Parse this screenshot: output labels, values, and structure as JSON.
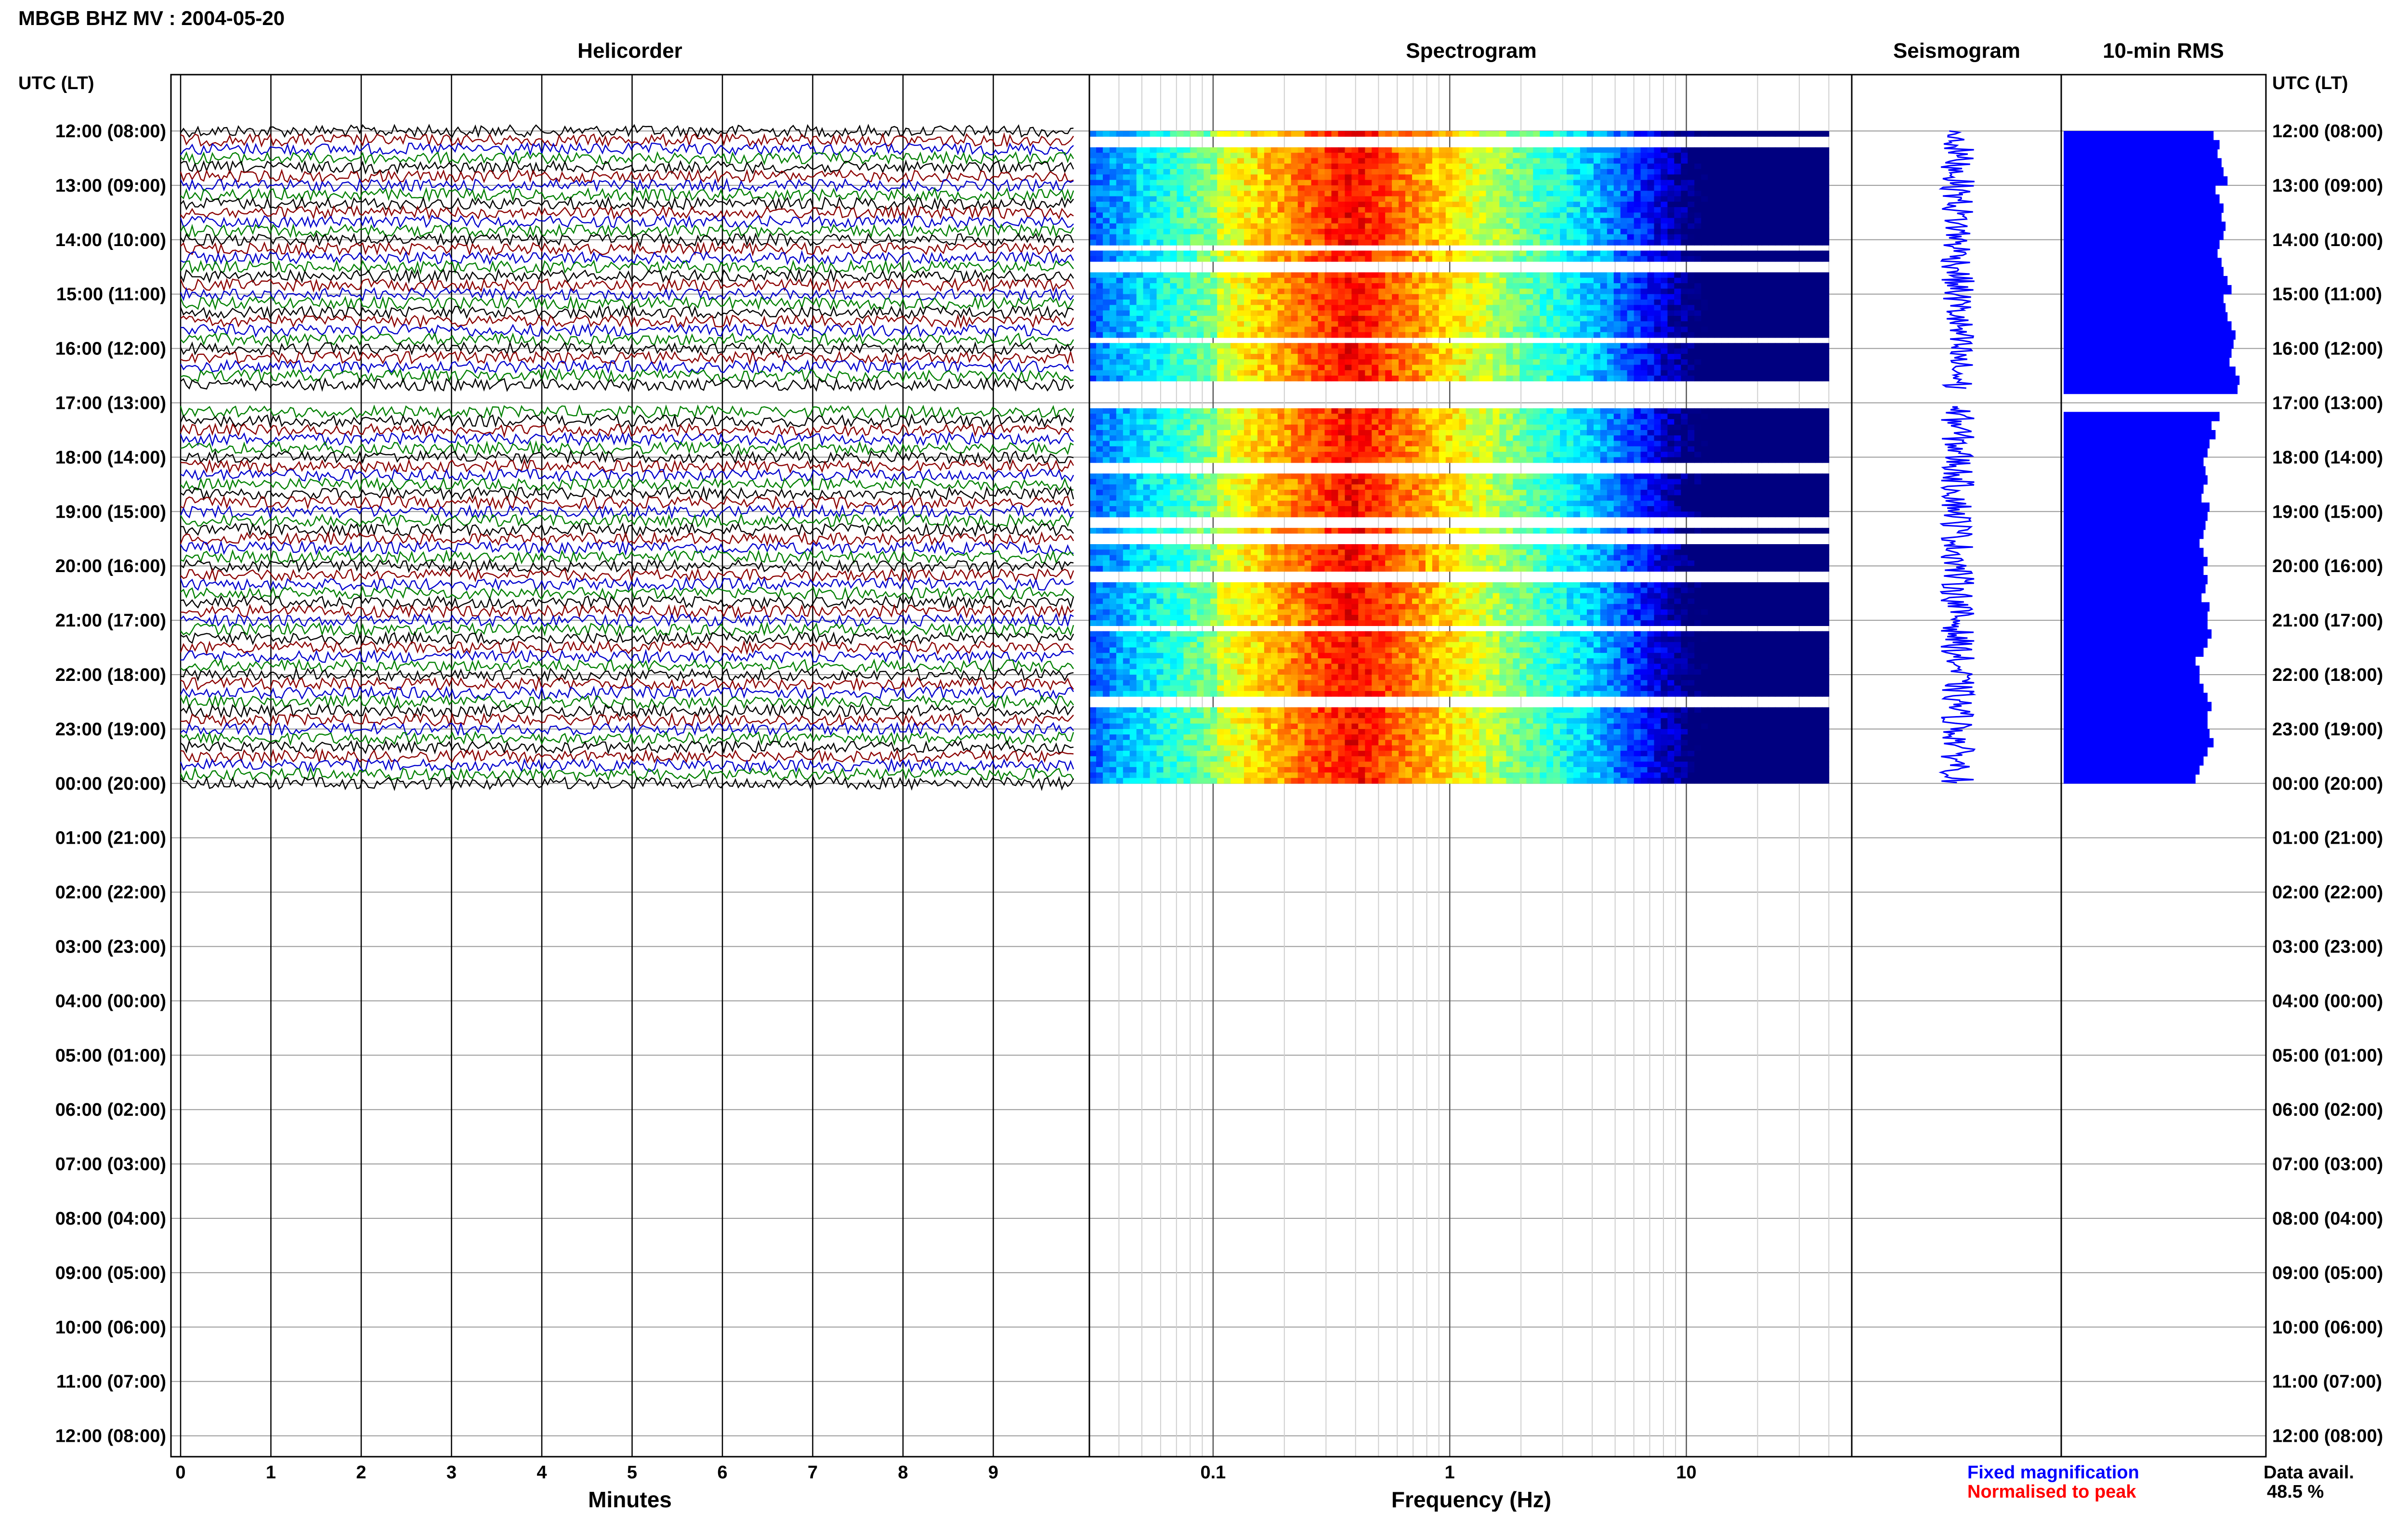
{
  "header": {
    "title": "MBGB BHZ MV : 2004-05-20",
    "utc_lt_label": "UTC (LT)"
  },
  "panels": {
    "helicorder": "Helicorder",
    "spectrogram": "Spectrogram",
    "seismogram": "Seismogram",
    "rms": "10-min RMS"
  },
  "footer": {
    "fixed_label": "Fixed magnification",
    "normalised_label": "Normalised to peak",
    "avail_label": "Data avail.",
    "avail_value": "48.5 %",
    "colors": {
      "fixed": "#0000ff",
      "normalised": "#ff0000"
    }
  },
  "chart_data": {
    "type": "heatmap",
    "time_labels": [
      "12:00 (08:00)",
      "13:00 (09:00)",
      "14:00 (10:00)",
      "15:00 (11:00)",
      "16:00 (12:00)",
      "17:00 (13:00)",
      "18:00 (14:00)",
      "19:00 (15:00)",
      "20:00 (16:00)",
      "21:00 (17:00)",
      "22:00 (18:00)",
      "23:00 (19:00)",
      "00:00 (20:00)",
      "01:00 (21:00)",
      "02:00 (22:00)",
      "03:00 (23:00)",
      "04:00 (00:00)",
      "05:00 (01:00)",
      "06:00 (02:00)",
      "07:00 (03:00)",
      "08:00 (04:00)",
      "09:00 (05:00)",
      "10:00 (06:00)",
      "11:00 (07:00)",
      "12:00 (08:00)"
    ],
    "helicorder": {
      "xlabel": "Minutes",
      "xticks": [
        "0",
        "1",
        "2",
        "3",
        "4",
        "5",
        "6",
        "7",
        "8",
        "9"
      ],
      "xlim": [
        0,
        10
      ],
      "trace_colors": [
        "#000000",
        "#8b0000",
        "#0000cd",
        "#008000"
      ],
      "data_hours": [
        0,
        12
      ],
      "gap_hours": [
        [
          4.75,
          5.05
        ]
      ]
    },
    "spectrogram": {
      "xlabel": "Frequency (Hz)",
      "xscale": "log",
      "xlim": [
        0.03,
        50
      ],
      "xticks": [
        "0.1",
        "1",
        "10"
      ],
      "data_fmax": 40,
      "peak_band_hz": [
        0.25,
        0.6
      ],
      "gap_hours": [
        0.2,
        2.15,
        2.5,
        3.85,
        4.7,
        5.05,
        6.2,
        7.2,
        7.5,
        8.2,
        9.15,
        10.5
      ]
    },
    "seismogram": {
      "data_hours": [
        0,
        12
      ]
    },
    "rms": {
      "scale_max": 1.0,
      "values": [
        0.75,
        0.78,
        0.77,
        0.79,
        0.8,
        0.82,
        0.76,
        0.78,
        0.8,
        0.79,
        0.81,
        0.8,
        0.78,
        0.77,
        0.79,
        0.8,
        0.82,
        0.84,
        0.8,
        0.81,
        0.82,
        0.84,
        0.86,
        0.85,
        0.84,
        0.83,
        0.86,
        0.88,
        0.87,
        0.8,
        0.75,
        0.78,
        0.74,
        0.76,
        0.73,
        0.72,
        0.7,
        0.71,
        0.72,
        0.7,
        0.69,
        0.73,
        0.72,
        0.71,
        0.7,
        0.68,
        0.7,
        0.72,
        0.7,
        0.72,
        0.71,
        0.69,
        0.73,
        0.72,
        0.72,
        0.74,
        0.72,
        0.7,
        0.66,
        0.68,
        0.68,
        0.7,
        0.72,
        0.74,
        0.72,
        0.72,
        0.73,
        0.75,
        0.72,
        0.7,
        0.68,
        0.66
      ],
      "gap_hours": [
        [
          4.75,
          5.05
        ]
      ]
    }
  }
}
